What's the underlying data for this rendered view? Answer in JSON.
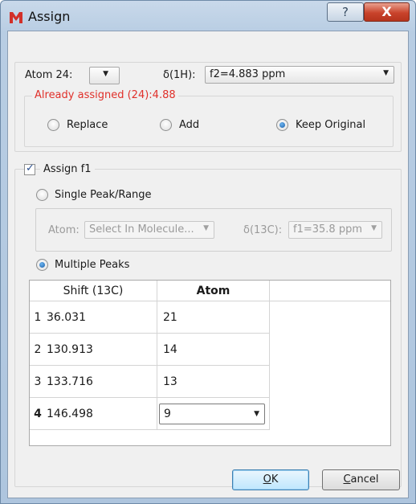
{
  "window": {
    "title": "Assign",
    "help_glyph": "?",
    "close_glyph": "X"
  },
  "atom_row": {
    "atom_label": "Atom 24:",
    "atom_combo_value": "",
    "delta_label": "δ(1H):",
    "delta_value": "f2=4.883 ppm"
  },
  "already_assigned": {
    "warning": "Already assigned (24):4.88",
    "options": [
      "Replace",
      "Add",
      "Keep Original"
    ],
    "selected": "Keep Original"
  },
  "assign_f1": {
    "label": "Assign f1",
    "checked": true,
    "single_label": "Single Peak/Range",
    "atom_label": "Atom:",
    "atom_placeholder": "Select In Molecule...",
    "delta13c_label": "δ(13C):",
    "delta13c_value": "f1=35.8 ppm",
    "multiple_label": "Multiple Peaks",
    "mode": "Multiple Peaks"
  },
  "table": {
    "headers": [
      "Shift (13C)",
      "Atom"
    ],
    "rows": [
      {
        "num": "1",
        "shift": "36.031",
        "atom": "21"
      },
      {
        "num": "2",
        "shift": "130.913",
        "atom": "14"
      },
      {
        "num": "3",
        "shift": "133.716",
        "atom": "13"
      },
      {
        "num": "4",
        "shift": "146.498",
        "atom": "9"
      }
    ]
  },
  "buttons": {
    "ok_mnemonic": "O",
    "ok_rest": "K",
    "cancel_mnemonic": "C",
    "cancel_rest": "ancel"
  },
  "colors": {
    "warning": "#e0302a",
    "accent": "#1b5fa8"
  },
  "icons": {
    "app": "app-logo-icon",
    "dropdown": "chevron-down-icon"
  }
}
